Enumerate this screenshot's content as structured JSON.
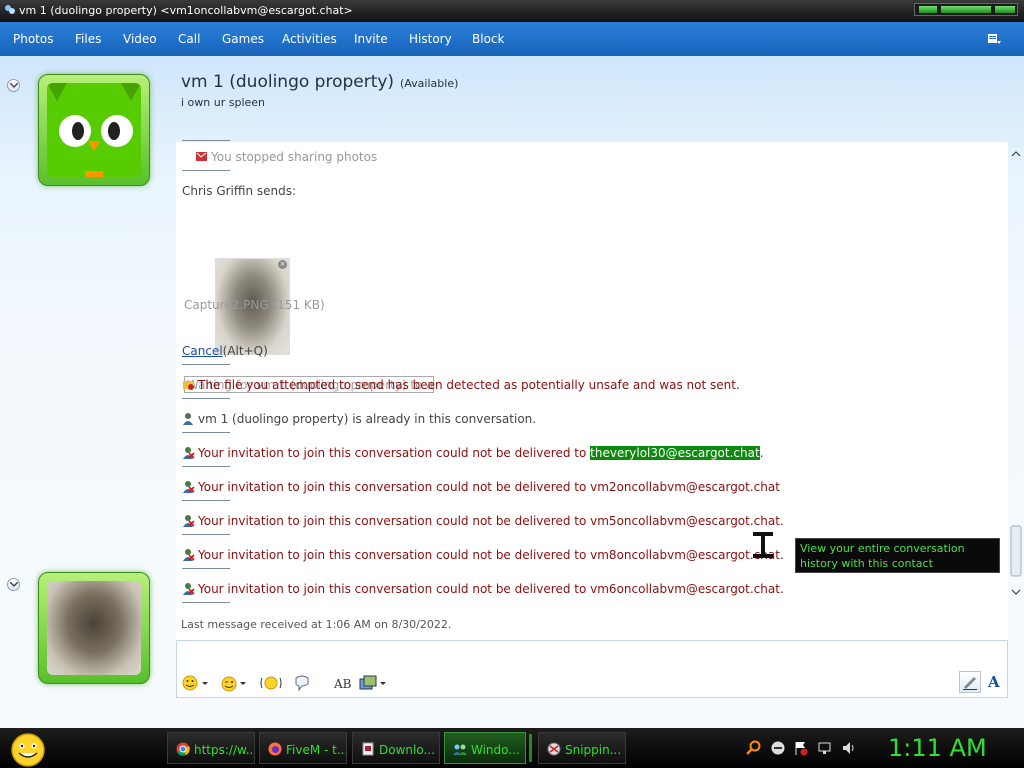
{
  "window": {
    "title": "vm 1 (duolingo property) <vm1oncollabvm@escargot.chat>"
  },
  "menu": {
    "items": [
      "Photos",
      "Files",
      "Video",
      "Call",
      "Games",
      "Activities",
      "Invite",
      "History",
      "Block"
    ]
  },
  "contact": {
    "name": "vm 1 (duolingo property)",
    "status": "(Available)",
    "personal_message": "i own ur spleen"
  },
  "conversation": {
    "photo_notice": "You stopped sharing photos",
    "sender_line": "Chris Griffin sends:",
    "file_name": "Capture2.PNG (151 KB)",
    "waiting_text": "Waiting for vm 1 (duolingo property) to ac...",
    "cancel_link": "Cancel",
    "cancel_shortcut": "(Alt+Q)",
    "unsafe_notice": "The file you attempted to send has been detected as potentially unsafe and was not sent.",
    "already_in": "vm 1 (duolingo property) is already in this conversation.",
    "invite_prefix": "Your invitation to join this conversation could not be delivered to",
    "invite_failures": [
      {
        "email": "theverylol30@escargot.chat",
        "suffix": "."
      },
      {
        "email": "vm2oncollabvm@escargot.chat",
        "suffix": ""
      },
      {
        "email": "vm5oncollabvm@escargot.chat",
        "suffix": "."
      },
      {
        "email": "vm8oncollabvm@escargot.chat",
        "suffix": "."
      },
      {
        "email": "vm6oncollabvm@escargot.chat",
        "suffix": "."
      }
    ],
    "last_message": "Last message received at 1:06 AM on 8/30/2022."
  },
  "tooltip": {
    "text": "View your entire conversation history with this contact"
  },
  "taskbar": {
    "items": [
      {
        "label": "https://w...",
        "icon": "chrome-icon"
      },
      {
        "label": "FiveM - t...",
        "icon": "firefox-icon"
      },
      {
        "label": "Downlo...",
        "icon": "download-icon"
      },
      {
        "label": "Windo...",
        "icon": "messenger-icon"
      },
      {
        "label": "Snippin...",
        "icon": "snipping-icon"
      }
    ],
    "clock": "1:11 AM"
  },
  "colors": {
    "accent_green": "#2fe02f",
    "menu_blue": "#1f6fc8",
    "error_red": "#8b0f0f",
    "highlight_green": "#0d8a0d"
  }
}
